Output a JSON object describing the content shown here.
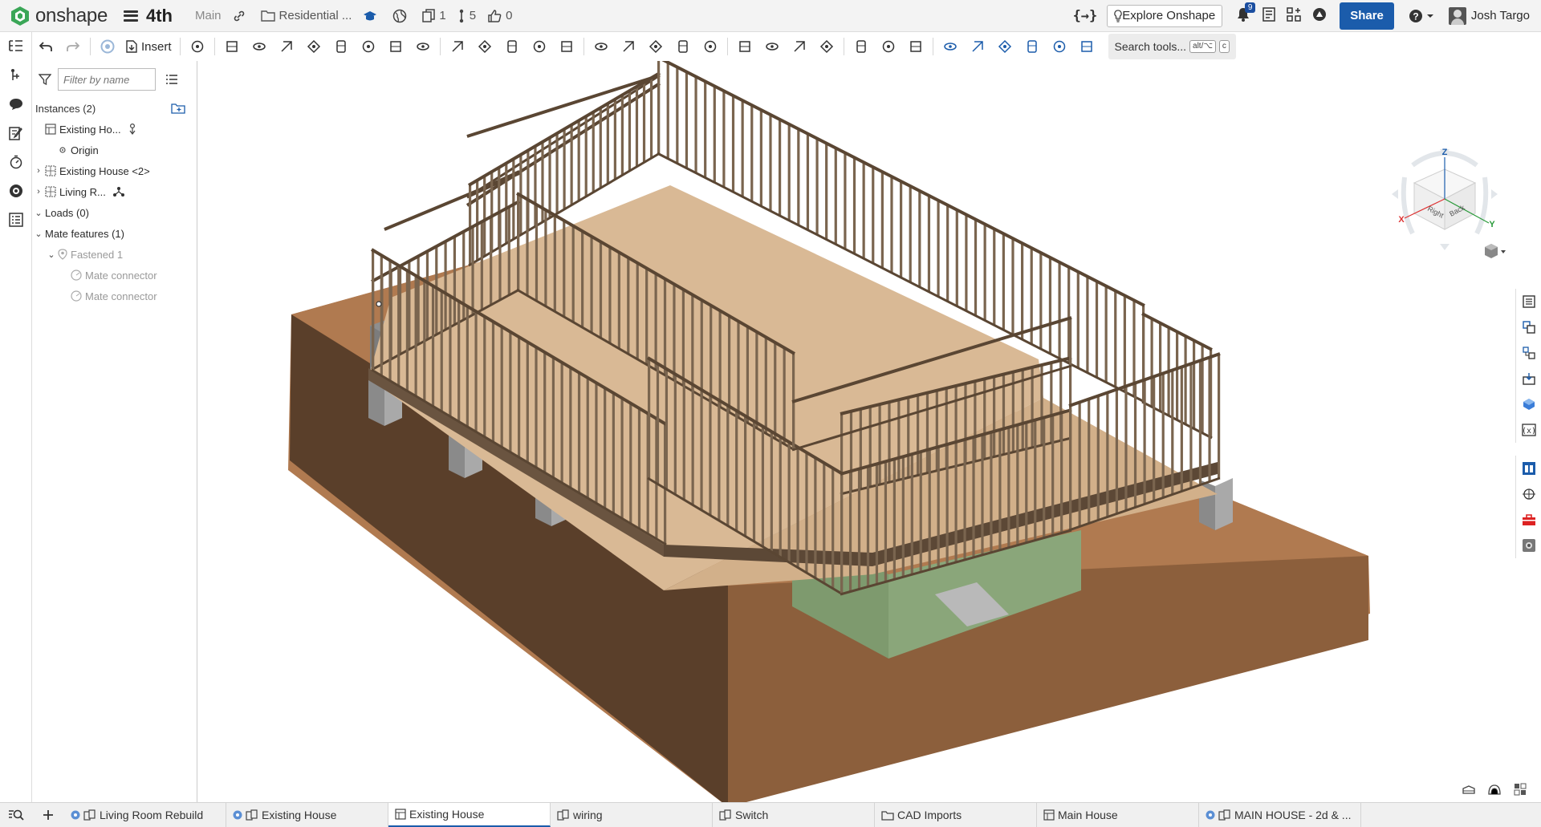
{
  "app": {
    "logo_text": "onshape",
    "document_name": "4th",
    "branch": "Main",
    "folder_label": "Residential ...",
    "copies_count": "1",
    "versions_count": "5",
    "likes_count": "0"
  },
  "header": {
    "variables_label": "{→}",
    "explore_label": "Explore Onshape",
    "notifications_count": "9",
    "share_label": "Share",
    "user_name": "Josh Targo"
  },
  "toolbar": {
    "insert_label": "Insert",
    "search_label": "Search tools...",
    "search_shortcut_1": "alt/⌥",
    "search_shortcut_2": "c"
  },
  "panel": {
    "filter_placeholder": "Filter by name",
    "instances_label": "Instances (2)",
    "items": [
      {
        "label": "Existing Ho...",
        "level": 0,
        "chevron": ""
      },
      {
        "label": "Origin",
        "level": 1,
        "chevron": ""
      },
      {
        "label": "Existing House <2>",
        "level": 0,
        "chevron": "›"
      },
      {
        "label": "Living R...",
        "level": 0,
        "chevron": "›"
      },
      {
        "label": "Loads (0)",
        "level": 0,
        "chevron": "⌄"
      },
      {
        "label": "Mate features (1)",
        "level": 0,
        "chevron": "⌄"
      },
      {
        "label": "Fastened 1",
        "level": 1,
        "chevron": "⌄"
      },
      {
        "label": "Mate connector",
        "level": 2,
        "chevron": ""
      },
      {
        "label": "Mate connector",
        "level": 2,
        "chevron": ""
      }
    ]
  },
  "viewcube": {
    "z_label": "Z",
    "x_label": "X",
    "y_label": "Y",
    "right_face": "Right",
    "back_face": "Back"
  },
  "tabs": [
    {
      "label": "Living Room Rebuild",
      "active": false
    },
    {
      "label": "Existing House",
      "active": false
    },
    {
      "label": "Existing House",
      "active": true
    },
    {
      "label": "wiring",
      "active": false
    },
    {
      "label": "Switch",
      "active": false
    },
    {
      "label": "CAD Imports",
      "active": false
    },
    {
      "label": "Main House",
      "active": false
    },
    {
      "label": "MAIN HOUSE - 2d & ...",
      "active": false
    }
  ],
  "colors": {
    "accent": "#1b5cab",
    "ground_top": "#b07a50",
    "ground_side_left": "#5a3f2a",
    "ground_side_right": "#8c5f3c",
    "stud": "#7a654f",
    "floor": "#d9b995",
    "concrete": "#8e8e8e",
    "siding": "#7e9a6e"
  }
}
